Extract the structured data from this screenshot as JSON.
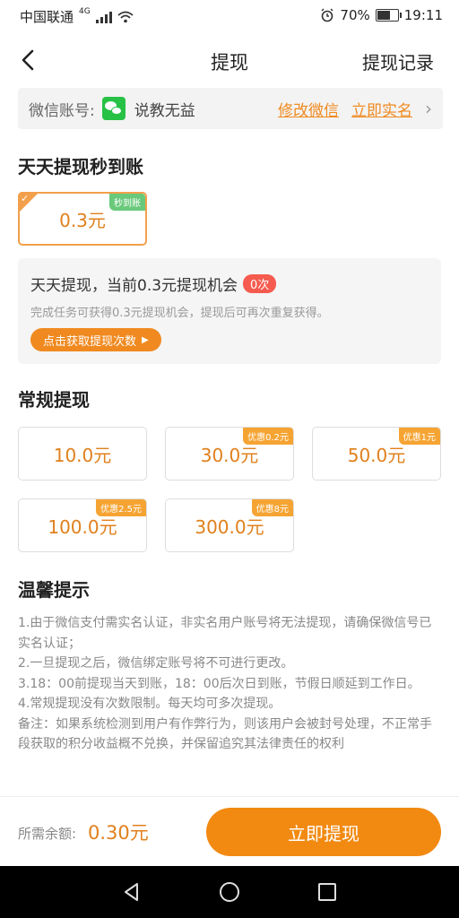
{
  "status_bar": {
    "carrier": "中国联通",
    "network": "4G",
    "battery": "70%",
    "battery_level": 0.7,
    "time": "19:11"
  },
  "header": {
    "title": "提现",
    "right_link": "提现记录"
  },
  "account": {
    "label": "微信账号:",
    "name": "说教无益",
    "edit_link": "修改微信",
    "verify_link": "立即实名"
  },
  "daily": {
    "title": "天天提现秒到账",
    "option": {
      "amount": "0.3元",
      "badge": "秒到账"
    },
    "info_text": "天天提现，当前0.3元提现机会",
    "count": "0次",
    "sub_text": "完成任务可获得0.3元提现机会，提现后可再次重复获得。",
    "button": "点击获取提现次数"
  },
  "regular": {
    "title": "常规提现",
    "options": [
      {
        "amount": "10.0元",
        "badge": ""
      },
      {
        "amount": "30.0元",
        "badge": "优惠0.2元"
      },
      {
        "amount": "50.0元",
        "badge": "优惠1元"
      },
      {
        "amount": "100.0元",
        "badge": "优惠2.5元"
      },
      {
        "amount": "300.0元",
        "badge": "优惠8元"
      }
    ]
  },
  "tips": {
    "title": "温馨提示",
    "lines": [
      "1.由于微信支付需实名认证，非实名用户账号将无法提现，请确保微信号已实名认证；",
      "2.一旦提现之后，微信绑定账号将不可进行更改。",
      "3.18：00前提现当天到账，18：00后次日到账，节假日顺延到工作日。",
      "4.常规提现没有次数限制。每天均可多次提现。",
      "备注：如果系统检测到用户有作弊行为，则该用户会被封号处理，不正常手段获取的积分收益概不兑换，并保留追究其法律责任的权利"
    ]
  },
  "footer": {
    "label": "所需余额:",
    "amount": "0.30元",
    "button": "立即提现"
  },
  "colors": {
    "accent": "#f08a20",
    "button": "#f28a12",
    "wechat": "#27c146",
    "count_badge": "#f65b4f"
  }
}
